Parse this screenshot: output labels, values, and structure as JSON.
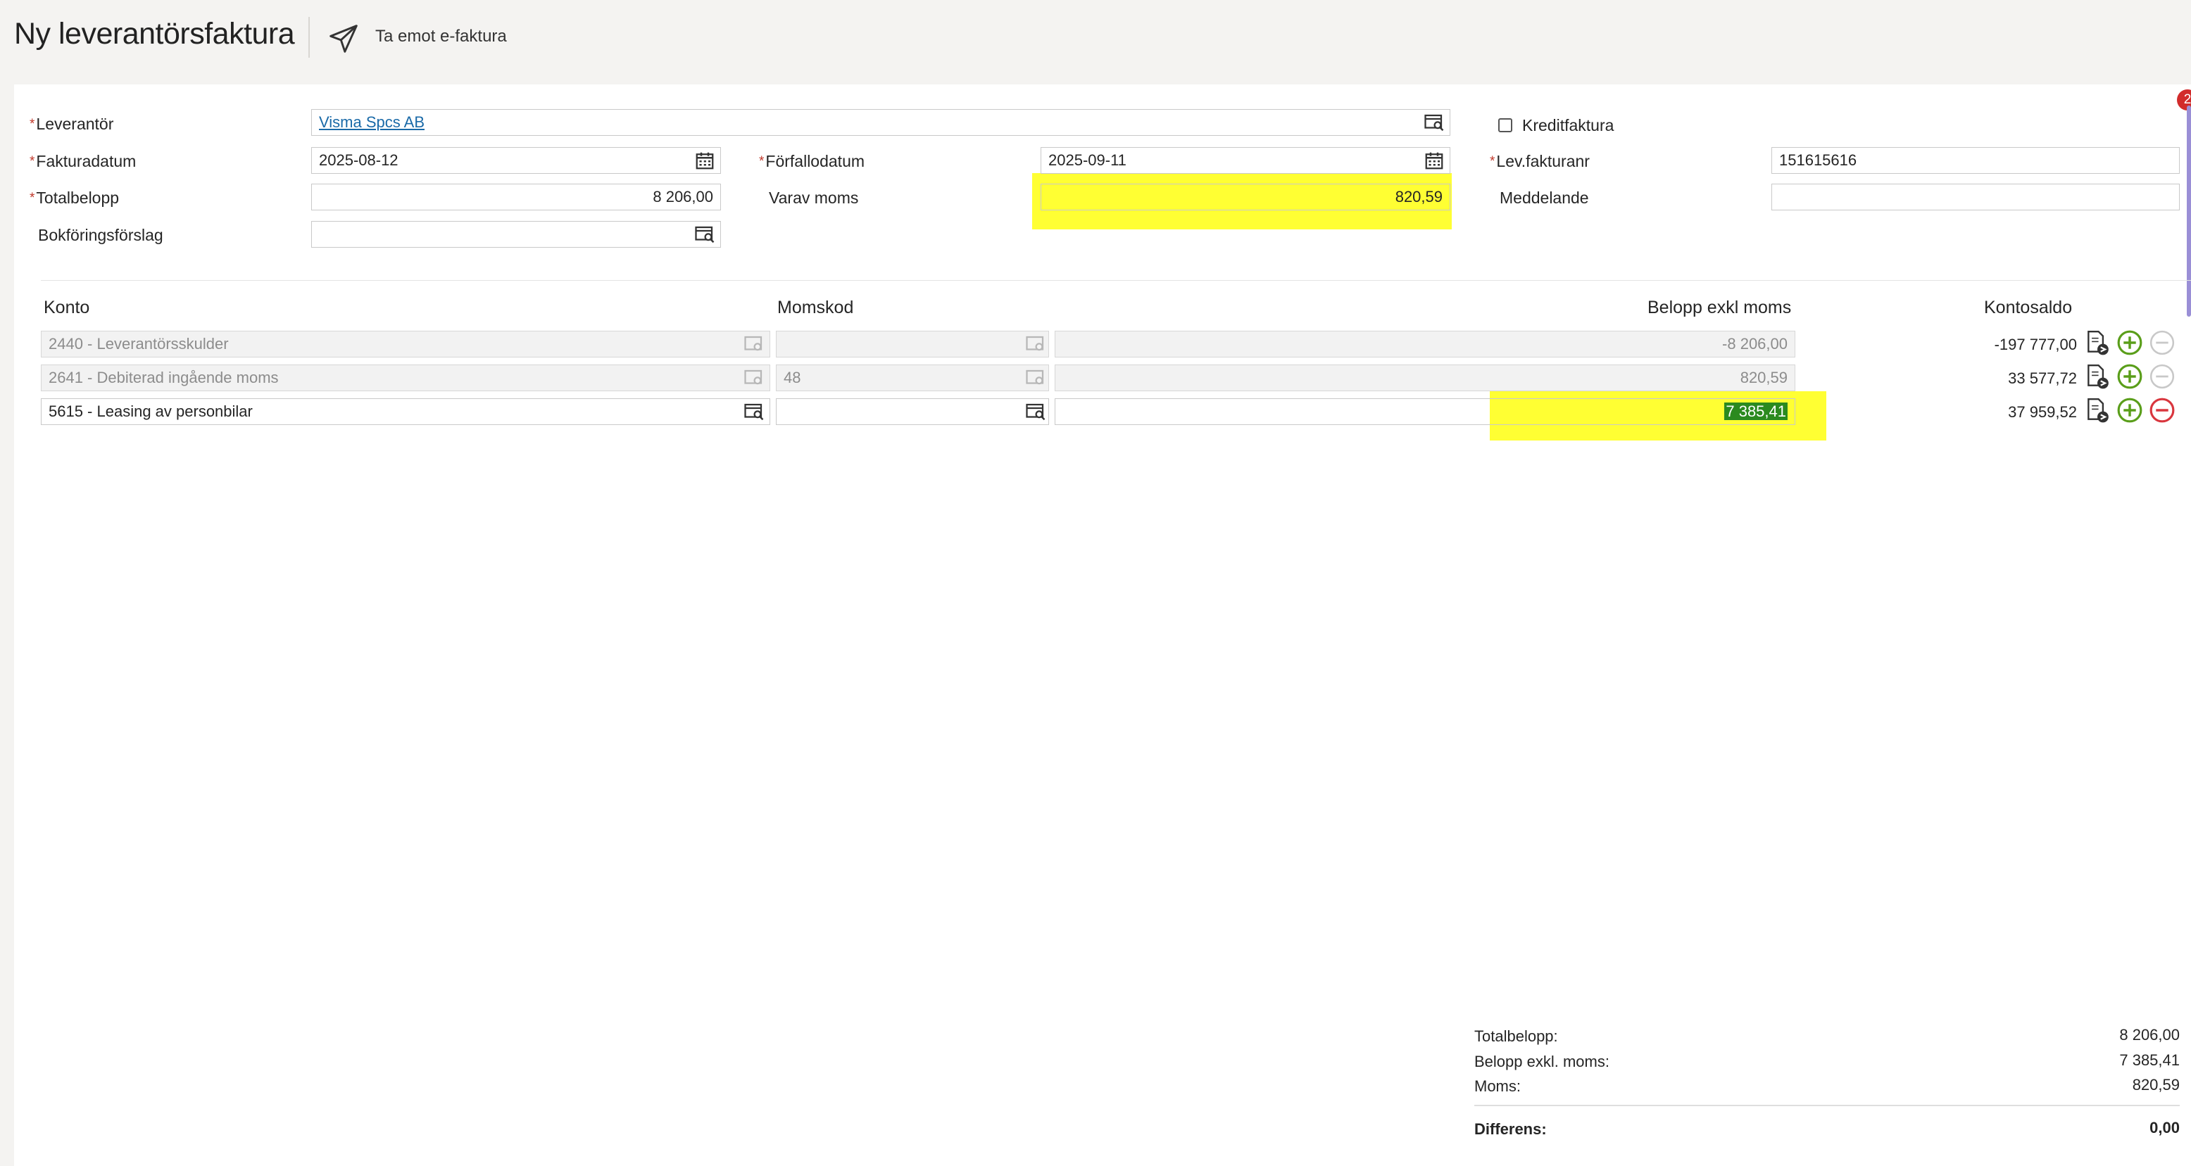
{
  "header": {
    "title": "Ny leverantörsfaktura",
    "action_label": "Ta emot e-faktura"
  },
  "badge": {
    "count": "2"
  },
  "form": {
    "leverantor": {
      "label": "Leverantör",
      "value": "Visma Spcs AB"
    },
    "fakturadatum": {
      "label": "Fakturadatum",
      "value": "2025-08-12"
    },
    "forfallodatum": {
      "label": "Förfallodatum",
      "value": "2025-09-11"
    },
    "totalbelopp": {
      "label": "Totalbelopp",
      "value": "8 206,00"
    },
    "varav_moms": {
      "label": "Varav moms",
      "value": "820,59"
    },
    "bokforingsforslag": {
      "label": "Bokföringsförslag",
      "value": ""
    },
    "kreditfaktura": {
      "label": "Kreditfaktura",
      "checked": false
    },
    "lev_fakturanr": {
      "label": "Lev.fakturanr",
      "value": "151615616"
    },
    "meddelande": {
      "label": "Meddelande",
      "value": ""
    }
  },
  "table": {
    "headers": {
      "konto": "Konto",
      "momskod": "Momskod",
      "belopp": "Belopp exkl moms",
      "kontosaldo": "Kontosaldo"
    },
    "rows": [
      {
        "konto": "2440 - Leverantörsskulder",
        "momskod": "",
        "belopp": "-8 206,00",
        "saldo": "-197 777,00",
        "disabled": true
      },
      {
        "konto": "2641 - Debiterad ingående moms",
        "momskod": "48",
        "belopp": "820,59",
        "saldo": "33 577,72",
        "disabled": true
      },
      {
        "konto": "5615 - Leasing av personbilar",
        "momskod": "",
        "belopp": "7 385,41",
        "saldo": "37 959,52",
        "disabled": false
      }
    ]
  },
  "summary": {
    "totalbelopp_label": "Totalbelopp:",
    "totalbelopp_value": "8 206,00",
    "exkl_label": "Belopp exkl. moms:",
    "exkl_value": "7 385,41",
    "moms_label": "Moms:",
    "moms_value": "820,59",
    "diff_label": "Differens:",
    "diff_value": "0,00"
  },
  "colors": {
    "highlight": "#ffff33",
    "required": "#c0392b",
    "link": "#1a6aa8",
    "add": "#5a9e1a",
    "remove": "#d9363e"
  }
}
